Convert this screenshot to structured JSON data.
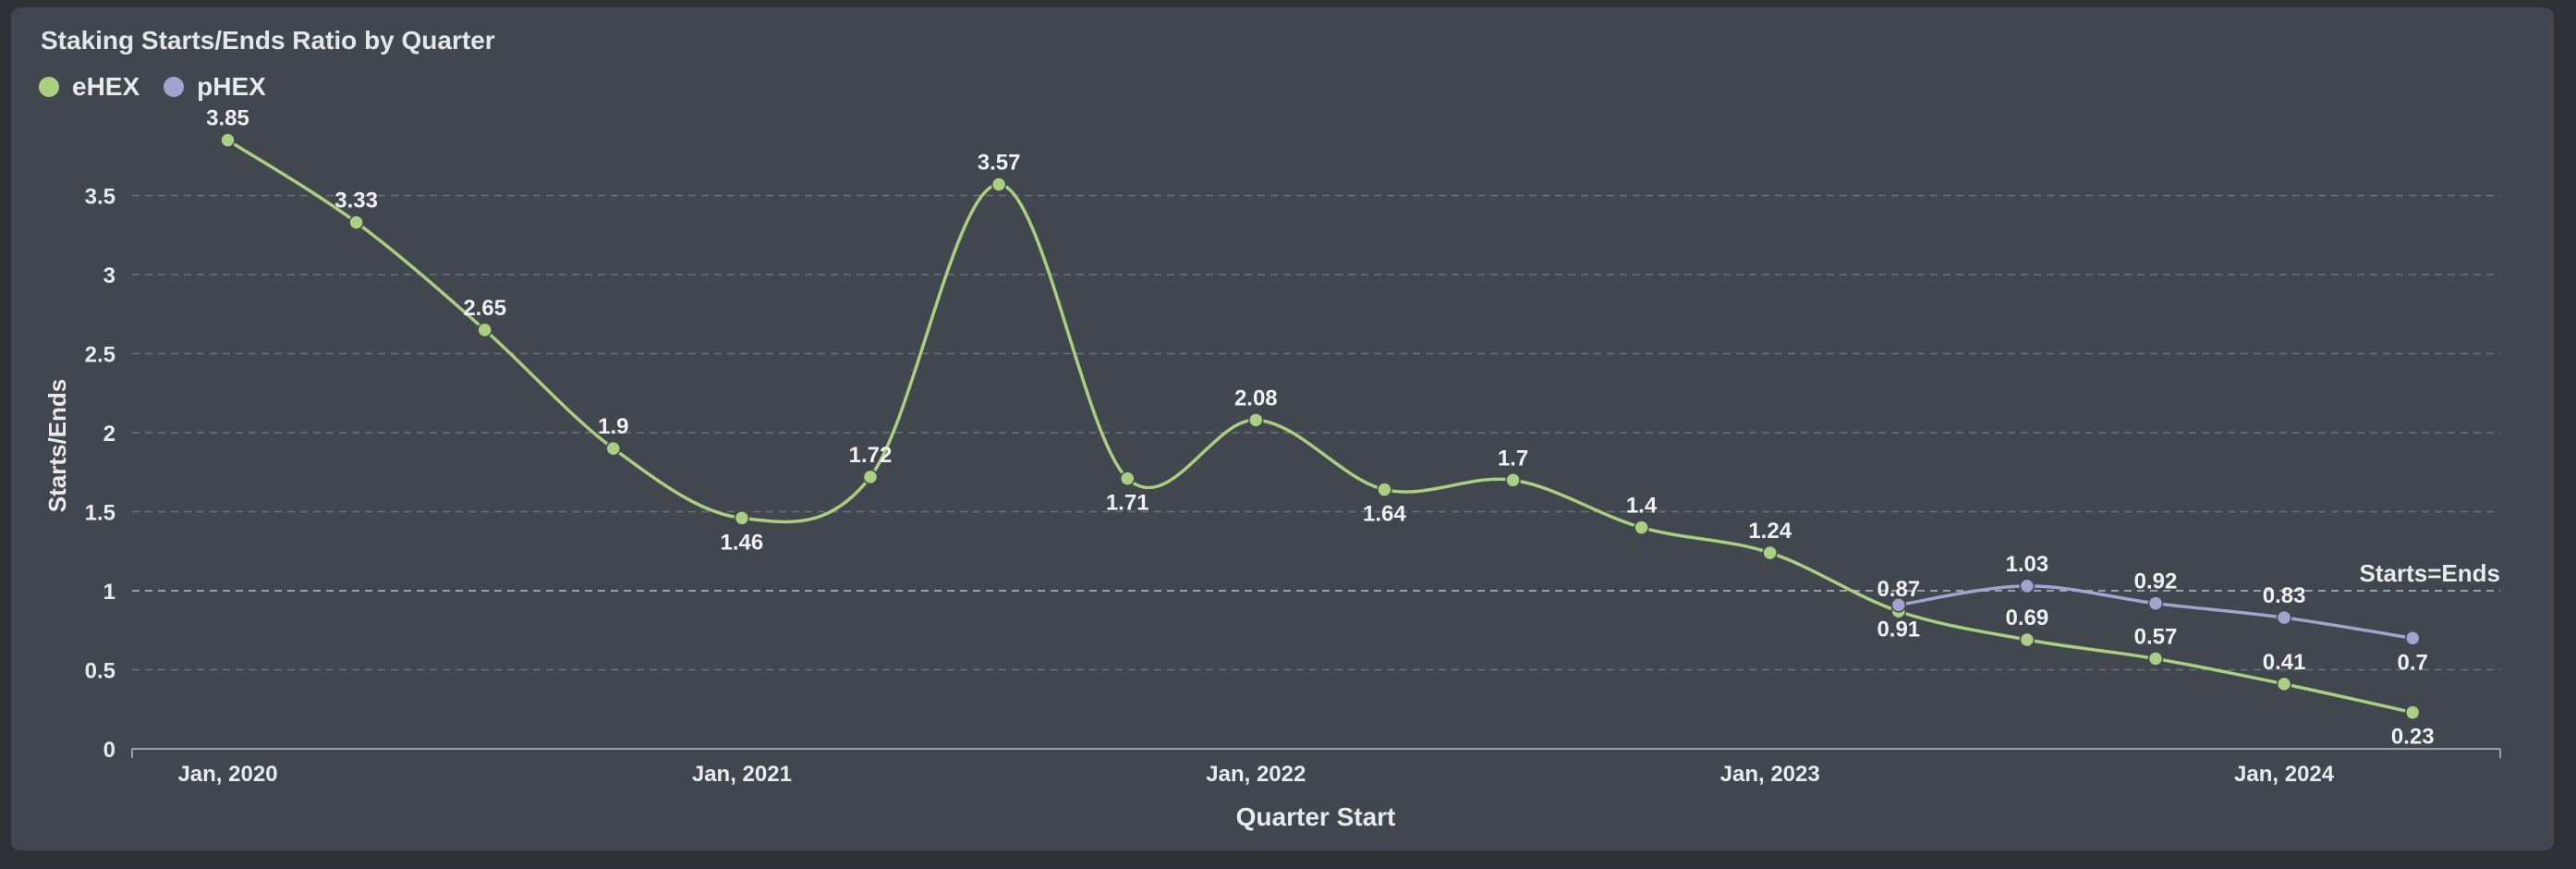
{
  "chart_data": {
    "type": "line",
    "title": "Staking Starts/Ends Ratio by Quarter",
    "xlabel": "Quarter Start",
    "ylabel": "Starts/Ends",
    "ylim": [
      0,
      4
    ],
    "yticks": [
      "0",
      "0.5",
      "1",
      "1.5",
      "2",
      "2.5",
      "3",
      "3.5"
    ],
    "ytick_values": [
      0,
      0.5,
      1,
      1.5,
      2,
      2.5,
      3,
      3.5
    ],
    "x_categories": [
      "2020-Q1",
      "2020-Q2",
      "2020-Q3",
      "2020-Q4",
      "2021-Q1",
      "2021-Q2",
      "2021-Q3",
      "2021-Q4",
      "2022-Q1",
      "2022-Q2",
      "2022-Q3",
      "2022-Q4",
      "2023-Q1",
      "2023-Q2",
      "2023-Q3",
      "2023-Q4",
      "2024-Q1",
      "2024-Q2"
    ],
    "xtick_labels": [
      {
        "label": "Jan, 2020",
        "index": 0
      },
      {
        "label": "Jan, 2021",
        "index": 4
      },
      {
        "label": "Jan, 2022",
        "index": 8
      },
      {
        "label": "Jan, 2023",
        "index": 12
      },
      {
        "label": "Jan, 2024",
        "index": 16
      }
    ],
    "grid": true,
    "legend_position": "top-left",
    "reference_line": {
      "value": 1,
      "label": "Starts=Ends"
    },
    "series": [
      {
        "name": "eHEX",
        "color": "#a8d080",
        "start_index": 0,
        "values": [
          3.85,
          3.33,
          2.65,
          1.9,
          1.46,
          1.72,
          3.57,
          1.71,
          2.08,
          1.64,
          1.7,
          1.4,
          1.24,
          0.87,
          0.69,
          0.57,
          0.41,
          0.23
        ],
        "labels": [
          "3.85",
          "3.33",
          "2.65",
          "1.9",
          "1.46",
          "1.72",
          "3.57",
          "1.71",
          "2.08",
          "1.64",
          "1.7",
          "1.4",
          "1.24",
          "0.87",
          "0.69",
          "0.57",
          "0.41",
          "0.23"
        ]
      },
      {
        "name": "pHEX",
        "color": "#a3a3cf",
        "start_index": 13,
        "values": [
          0.91,
          1.03,
          0.92,
          0.83,
          0.7
        ],
        "labels": [
          "0.91",
          "1.03",
          "0.92",
          "0.83",
          "0.7"
        ]
      }
    ]
  }
}
